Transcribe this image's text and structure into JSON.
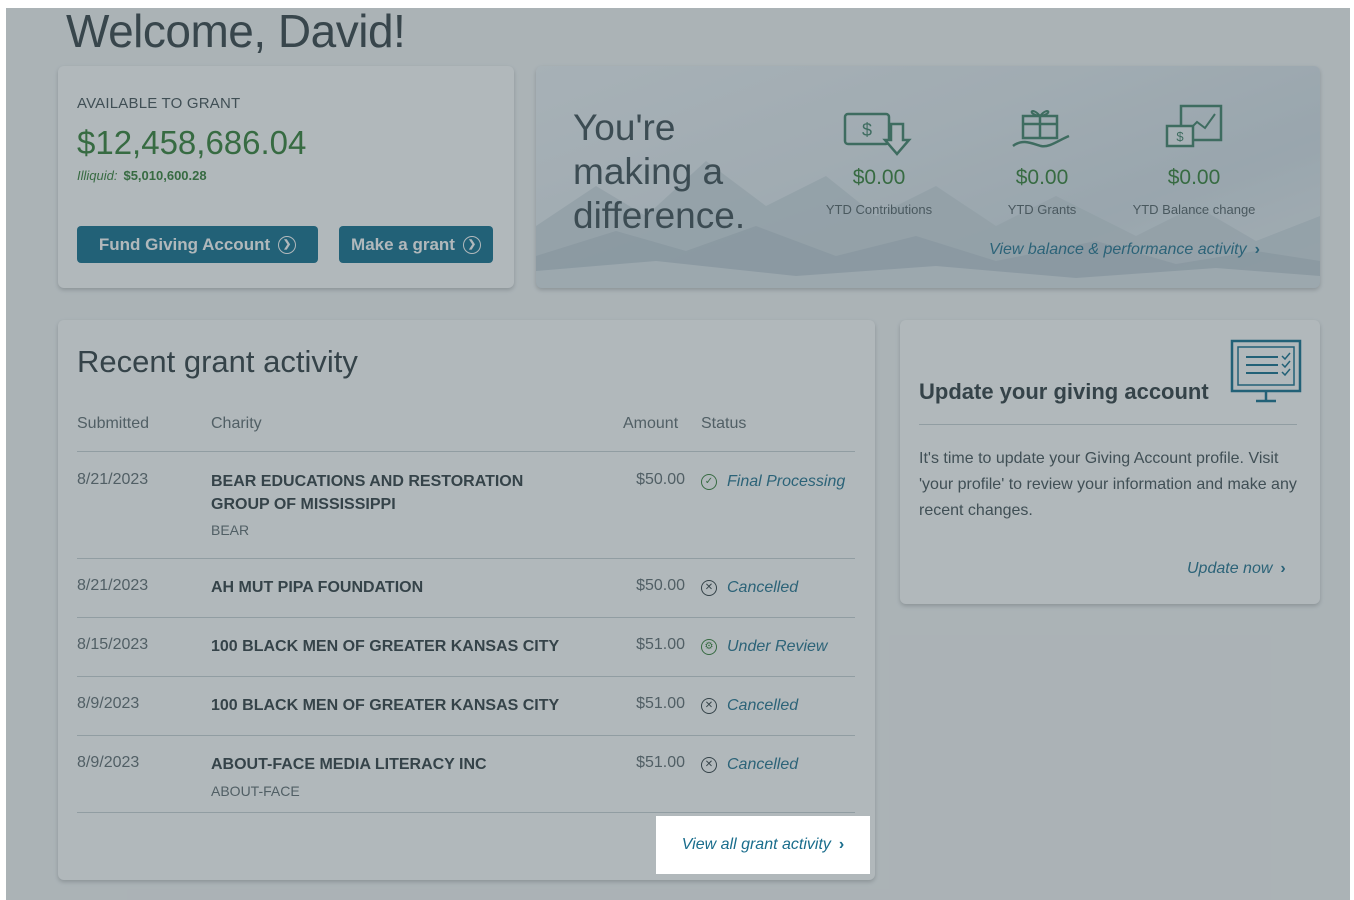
{
  "welcome": "Welcome, David!",
  "available": {
    "label": "AVAILABLE TO GRANT",
    "amount": "$12,458,686.04",
    "illiquid_label": "Illiquid:",
    "illiquid_value": "$5,010,600.28",
    "fund_button": "Fund Giving Account",
    "grant_button": "Make a grant"
  },
  "impact": {
    "tagline_1": "You're",
    "tagline_2": "making a",
    "tagline_3": "difference.",
    "stats": [
      {
        "value": "$0.00",
        "caption": "YTD Contributions",
        "icon": "contribution-icon"
      },
      {
        "value": "$0.00",
        "caption": "YTD Grants",
        "icon": "gift-icon"
      },
      {
        "value": "$0.00",
        "caption": "YTD Balance change",
        "icon": "balance-chart-icon"
      }
    ],
    "link": "View balance & performance activity"
  },
  "grants": {
    "title": "Recent grant activity",
    "columns": [
      "Submitted",
      "Charity",
      "Amount",
      "Status"
    ],
    "rows": [
      {
        "date": "8/21/2023",
        "charity": "BEAR EDUCATIONS AND RESTORATION GROUP OF MISSISSIPPI",
        "alias": "BEAR",
        "amount": "$50.00",
        "status": "Final Processing"
      },
      {
        "date": "8/21/2023",
        "charity": "AH MUT PIPA FOUNDATION",
        "alias": "",
        "amount": "$50.00",
        "status": "Cancelled"
      },
      {
        "date": "8/15/2023",
        "charity": "100 BLACK MEN OF GREATER KANSAS CITY",
        "alias": "",
        "amount": "$51.00",
        "status": "Under Review"
      },
      {
        "date": "8/9/2023",
        "charity": "100 BLACK MEN OF GREATER KANSAS CITY",
        "alias": "",
        "amount": "$51.00",
        "status": "Cancelled"
      },
      {
        "date": "8/9/2023",
        "charity": "ABOUT-FACE MEDIA LITERACY INC",
        "alias": "ABOUT-FACE",
        "amount": "$51.00",
        "status": "Cancelled"
      }
    ],
    "view_all": "View all grant activity"
  },
  "update": {
    "title": "Update your giving account",
    "body": "It's time to update your Giving Account profile. Visit 'your profile' to review your information and make any recent changes.",
    "link": "Update now"
  },
  "colors": {
    "accent": "#0a6a8a",
    "money": "#2e7a2f",
    "link": "#1a6d8c",
    "overlay": "#46555c"
  }
}
